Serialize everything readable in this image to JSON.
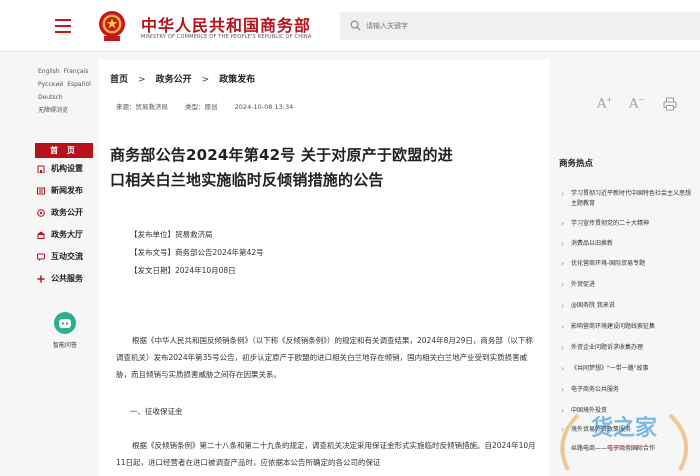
{
  "header": {
    "site_title": "中华人民共和国商务部",
    "site_subtitle": "MINISTRY OF COMMERCE OF THE PEOPLE'S REPUBLIC OF CHINA",
    "search_placeholder": "请输入关键字"
  },
  "languages": {
    "row1": [
      "English",
      "Français"
    ],
    "row2": [
      "Русский",
      "Español"
    ],
    "row3": [
      "Deutsch"
    ],
    "row4": [
      "无障碍浏览"
    ]
  },
  "sidebar": {
    "home_label": "首 页",
    "items": [
      {
        "label": "机构设置",
        "icon": "building-icon"
      },
      {
        "label": "新闻发布",
        "icon": "news-icon"
      },
      {
        "label": "政务公开",
        "icon": "document-icon"
      },
      {
        "label": "政务大厅",
        "icon": "hall-icon"
      },
      {
        "label": "互动交流",
        "icon": "chat-icon"
      },
      {
        "label": "公共服务",
        "icon": "service-icon"
      }
    ],
    "assistant_label": "智能问答"
  },
  "breadcrumb": [
    "首页",
    "政务公开",
    "政策发布"
  ],
  "meta": {
    "source": "来源：贸易救济局",
    "type": "类型：原创",
    "date": "2024-10-08 13:34"
  },
  "font_controls": {
    "larger": "A",
    "smaller": "A"
  },
  "article": {
    "title_line1": "商务部公告2024年第42号 关于对原产于欧盟的进",
    "title_line2": "口相关白兰地实施临时反倾销措施的公告",
    "issuer": "【发布单位】贸易救济局",
    "doc_no": "【发布文号】商务部公告2024年第42号",
    "issue_date": "【发文日期】2024年10月08日",
    "p1": "根据《中华人民共和国反倾销条例》（以下称《反倾销条例》）的规定和有关调查结果，2024年8月29日，商务部（以下称调查机关）发布2024年第35号公告，初步认定原产于欧盟的进口相关白兰地存在倾销，国内相关白兰地产业受到实质损害威胁，而且倾销与实质损害威胁之间存在因果关系。",
    "section1": "一、征收保证金",
    "p2": "根据《反倾销条例》第二十八条和第二十九条的规定，调查机关决定采用保证金形式实施临时反倾销措施。自2024年10月11日起，进口经营者在进口被调查产品时，应依据本公告所确定的各公司的保证"
  },
  "hot": {
    "title": "商务热点",
    "items": [
      "学习贯彻习近平新时代中国特色社会主义思想主题教育",
      "学习宣传贯彻党的二十大精神",
      "消费品以旧换新",
      "优化营商环境-国际贸易专题",
      "外贸促进",
      "@国务院 我来说",
      "影响营商环境建设问题线索征集",
      "外资企业问题诉求收集办理",
      "《共同梦想》\"一带一路\"故事",
      "电子商务公共服务",
      "中国境外投资",
      "境外贸易外资政策服务",
      "丝路电商——电子商务国际合作"
    ]
  },
  "watermark": {
    "text": "货之家",
    "url_text": "56hz.com"
  },
  "colors": {
    "brand": "#b5121b",
    "assistant": "#2eaf8f"
  }
}
